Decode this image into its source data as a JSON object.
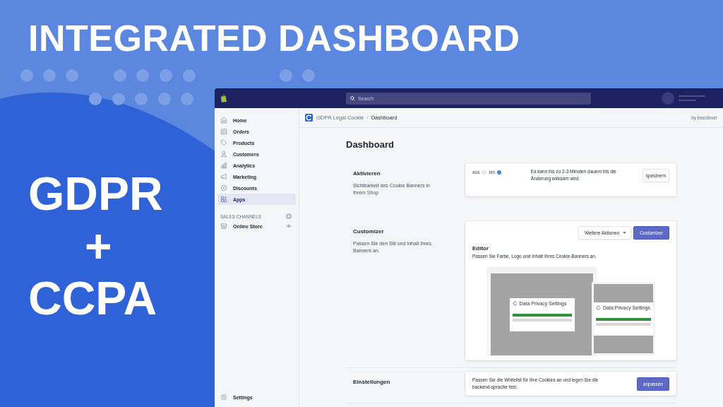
{
  "headline": "INTEGRATED DASHBOARD",
  "tagline": [
    "GDPR",
    "+",
    "CCPA"
  ],
  "app": {
    "search": {
      "placeholder": "Search"
    },
    "sidebar": {
      "items": [
        {
          "label": "Home",
          "selected": false
        },
        {
          "label": "Orders",
          "selected": false
        },
        {
          "label": "Products",
          "selected": false
        },
        {
          "label": "Customers",
          "selected": false
        },
        {
          "label": "Analytics",
          "selected": false
        },
        {
          "label": "Marketing",
          "selected": false
        },
        {
          "label": "Discounts",
          "selected": false
        },
        {
          "label": "Apps",
          "selected": true
        }
      ],
      "section_title": "SALES CHANNELS",
      "channels": [
        {
          "label": "Online Store"
        }
      ],
      "settings": "Settings"
    },
    "breadcrumb": {
      "app_name": "GDPR Legal Cookie",
      "separator": "/",
      "page": "Dashboard",
      "vendor": "by beeclever"
    },
    "page_title": "Dashboard",
    "sections": [
      {
        "kind": "toggle",
        "title": "Aktivieren",
        "description": "Sichtbarkeit des Cookie Banners in Ihrem Shop",
        "options": [
          {
            "label": "aus",
            "selected": false
          },
          {
            "label": "ein",
            "selected": true
          }
        ],
        "note": "Es kann bis zu 2-3 Minuten dauern bis die Änderung wirksam wird.",
        "button": "speichern"
      },
      {
        "kind": "editor",
        "title": "Customizer",
        "description": "Passen Sie den Stil und Inhalt Ihres Banners an.",
        "menu_button": "Weitere Aktionen",
        "primary_button": "Customizer",
        "heading": "Editor",
        "text": "Passen Sie Farbe, Logo und Inhalt Ihres Cookie-Banners an.",
        "preview": {
          "dialog_titles": [
            "Data Privacy Settings",
            "Data Privacy Settings"
          ]
        }
      },
      {
        "kind": "settings",
        "title": "Einstellungen",
        "text": "Passen Sie die Whitelist für Ihre Cookies an und legen Sie die backend-sprache fest.",
        "primary_button": "anpassen"
      }
    ]
  }
}
